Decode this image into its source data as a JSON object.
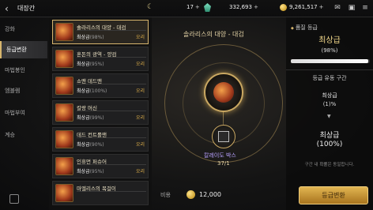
{
  "header": {
    "title": "대장간",
    "stat_a": "17",
    "plus_a": "+",
    "currency_gem": "332,693",
    "plus_b": "+",
    "currency_gold": "9,261,517",
    "plus_c": "+"
  },
  "nav": {
    "items": [
      {
        "label": "강화"
      },
      {
        "label": "등급변환"
      },
      {
        "label": "마법봉인"
      },
      {
        "label": "엠블렘"
      },
      {
        "label": "마법부여"
      },
      {
        "label": "계승"
      }
    ]
  },
  "list": {
    "items": [
      {
        "name": "솔라리스의 대양 - 대검",
        "grade": "최상급",
        "pct": "(98%)",
        "rank": "오리"
      },
      {
        "name": "혼돈의 광역 - 양검",
        "grade": "최상급",
        "pct": "(95%)",
        "rank": "오리"
      },
      {
        "name": "쇼맨 데드맨",
        "grade": "최상급",
        "pct": "(100%)",
        "rank": "오리"
      },
      {
        "name": "칼랑 머신",
        "grade": "최상급",
        "pct": "(99%)",
        "rank": "오리"
      },
      {
        "name": "데드 컨트롤맨",
        "grade": "최상급",
        "pct": "(90%)",
        "rank": "오리"
      },
      {
        "name": "인휴먼 퍼슈어",
        "grade": "최상급",
        "pct": "(95%)",
        "rank": "오리"
      },
      {
        "name": "마엘리스의 목걸이",
        "grade": "",
        "pct": "",
        "rank": ""
      }
    ]
  },
  "center": {
    "title": "솔라리스의 대양 - 대검",
    "material_name": "칼레이도 박스",
    "material_count": "37/1",
    "cost_label": "비용",
    "cost_value": "12,000"
  },
  "panel": {
    "section1": "품질 등급",
    "grade": "최상급",
    "grade_pct": "(98%)",
    "quality_fraction": 0.98,
    "section2": "등급 유동 구간",
    "range_grade": "최상급",
    "range_pct": "(1)%",
    "arrow": "▼",
    "result_grade": "최상급",
    "result_pct": "(100%)",
    "note": "구간 내 확률은 동일합니다.",
    "button": "등급변환"
  },
  "colors": {
    "accent_gold": "#d7b56d",
    "grade_gold": "#f1d78a",
    "material_purple": "#b9a2ff"
  }
}
